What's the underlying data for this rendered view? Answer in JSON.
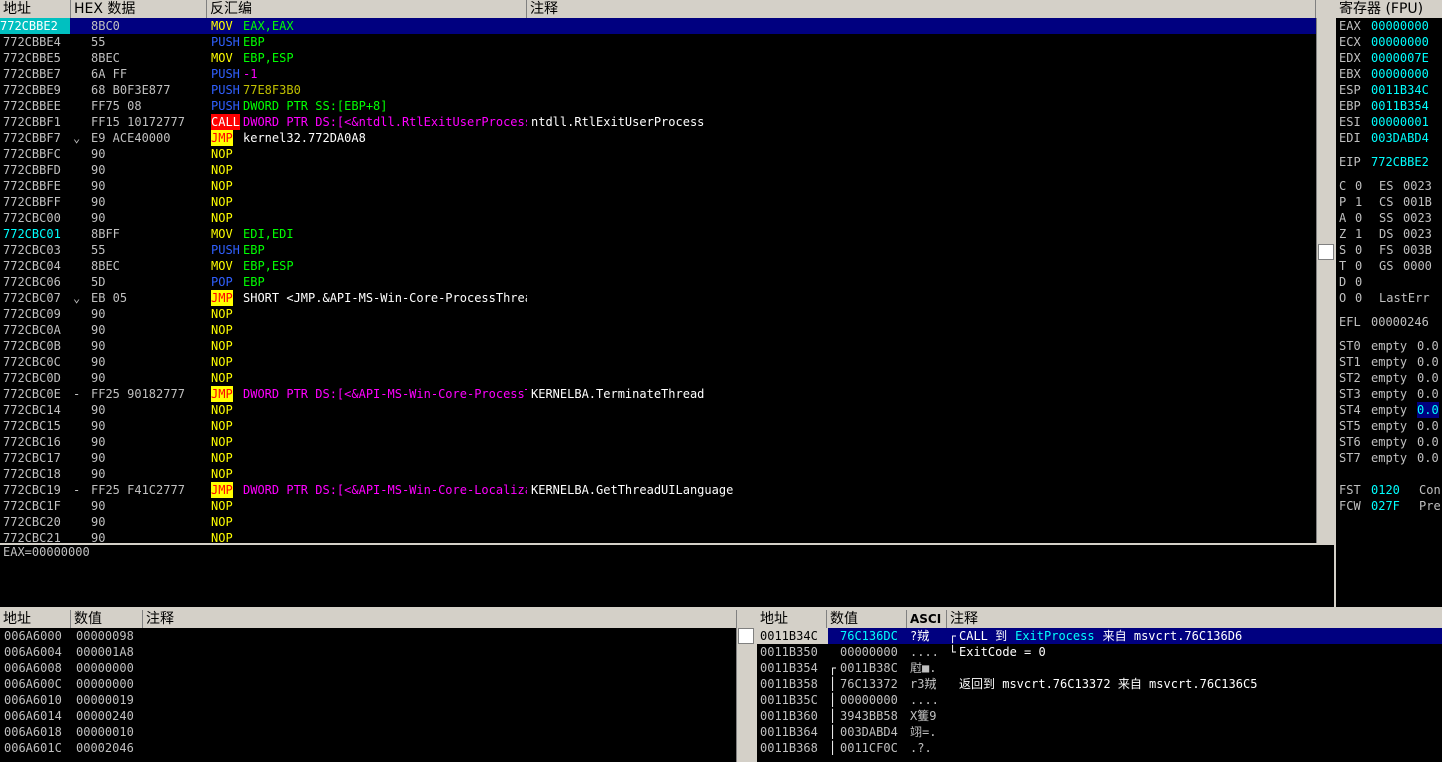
{
  "disasm": {
    "headers": [
      "地址",
      "HEX 数据",
      "反汇编",
      "注释"
    ],
    "rows": [
      {
        "addr": "772CBBE2",
        "hex": "8BC0",
        "mn": "MOV",
        "mnc": "mov",
        "ops": [
          [
            "EAX,EAX",
            "reg"
          ]
        ],
        "cmt": "",
        "cur": true
      },
      {
        "addr": "772CBBE4",
        "hex": "55",
        "mn": "PUSH",
        "mnc": "push",
        "ops": [
          [
            "EBP",
            "reg"
          ]
        ],
        "cmt": ""
      },
      {
        "addr": "772CBBE5",
        "hex": "8BEC",
        "mn": "MOV",
        "mnc": "mov",
        "ops": [
          [
            "EBP,ESP",
            "reg"
          ]
        ],
        "cmt": ""
      },
      {
        "addr": "772CBBE7",
        "hex": "6A FF",
        "mn": "PUSH",
        "mnc": "push",
        "ops": [
          [
            "-1",
            "num"
          ]
        ],
        "cmt": ""
      },
      {
        "addr": "772CBBE9",
        "hex": "68 B0F3E877",
        "mn": "PUSH",
        "mnc": "push",
        "ops": [
          [
            "77E8F3B0",
            "const"
          ]
        ],
        "cmt": ""
      },
      {
        "addr": "772CBBEE",
        "hex": "FF75 08",
        "mn": "PUSH",
        "mnc": "push",
        "ops": [
          [
            "DWORD PTR SS:[EBP+8]",
            "reg"
          ]
        ],
        "cmt": ""
      },
      {
        "addr": "772CBBF1",
        "hex": "FF15 10172777",
        "mn": "CALL",
        "mnc": "call",
        "ops": [
          [
            "DWORD PTR DS:[<&ntdll.RtlExitUserProcess>]",
            "mem"
          ]
        ],
        "cmt": "ntdll.RtlExitUserProcess"
      },
      {
        "addr": "772CBBF7",
        "arrow": "⌄",
        "hex": "E9 ACE40000",
        "mn": "JMP",
        "mnc": "jmp",
        "ops": [
          [
            "kernel32.772DA0A8",
            "lbl"
          ]
        ],
        "cmt": ""
      },
      {
        "addr": "772CBBFC",
        "hex": "90",
        "mn": "NOP",
        "mnc": "nop",
        "ops": [],
        "cmt": ""
      },
      {
        "addr": "772CBBFD",
        "hex": "90",
        "mn": "NOP",
        "mnc": "nop",
        "ops": [],
        "cmt": ""
      },
      {
        "addr": "772CBBFE",
        "hex": "90",
        "mn": "NOP",
        "mnc": "nop",
        "ops": [],
        "cmt": ""
      },
      {
        "addr": "772CBBFF",
        "hex": "90",
        "mn": "NOP",
        "mnc": "nop",
        "ops": [],
        "cmt": ""
      },
      {
        "addr": "772CBC00",
        "hex": "90",
        "mn": "NOP",
        "mnc": "nop",
        "ops": [],
        "cmt": ""
      },
      {
        "addr": "772CBC01",
        "hex": "8BFF",
        "mn": "MOV",
        "mnc": "mov",
        "ops": [
          [
            "EDI,EDI",
            "reg"
          ]
        ],
        "cmt": "",
        "cyan": true
      },
      {
        "addr": "772CBC03",
        "hex": "55",
        "mn": "PUSH",
        "mnc": "push",
        "ops": [
          [
            "EBP",
            "reg"
          ]
        ],
        "cmt": ""
      },
      {
        "addr": "772CBC04",
        "hex": "8BEC",
        "mn": "MOV",
        "mnc": "mov",
        "ops": [
          [
            "EBP,ESP",
            "reg"
          ]
        ],
        "cmt": ""
      },
      {
        "addr": "772CBC06",
        "hex": "5D",
        "mn": "POP",
        "mnc": "pop",
        "ops": [
          [
            "EBP",
            "reg"
          ]
        ],
        "cmt": ""
      },
      {
        "addr": "772CBC07",
        "arrow": "⌄",
        "hex": "EB 05",
        "mn": "JMP",
        "mnc": "jmp",
        "ops": [
          [
            "SHORT <JMP.&API-MS-Win-Core-ProcessThreads>",
            "lbl"
          ]
        ],
        "cmt": ""
      },
      {
        "addr": "772CBC09",
        "hex": "90",
        "mn": "NOP",
        "mnc": "nop",
        "ops": [],
        "cmt": ""
      },
      {
        "addr": "772CBC0A",
        "hex": "90",
        "mn": "NOP",
        "mnc": "nop",
        "ops": [],
        "cmt": ""
      },
      {
        "addr": "772CBC0B",
        "hex": "90",
        "mn": "NOP",
        "mnc": "nop",
        "ops": [],
        "cmt": ""
      },
      {
        "addr": "772CBC0C",
        "hex": "90",
        "mn": "NOP",
        "mnc": "nop",
        "ops": [],
        "cmt": ""
      },
      {
        "addr": "772CBC0D",
        "hex": "90",
        "mn": "NOP",
        "mnc": "nop",
        "ops": [],
        "cmt": ""
      },
      {
        "addr": "772CBC0E",
        "arrow": "-",
        "hex": "FF25 90182777",
        "mn": "JMP",
        "mnc": "jmp",
        "ops": [
          [
            "DWORD PTR DS:[<&API-MS-Win-Core-ProcessThreads>]",
            "mem"
          ]
        ],
        "cmt": "KERNELBA.TerminateThread"
      },
      {
        "addr": "772CBC14",
        "hex": "90",
        "mn": "NOP",
        "mnc": "nop",
        "ops": [],
        "cmt": ""
      },
      {
        "addr": "772CBC15",
        "hex": "90",
        "mn": "NOP",
        "mnc": "nop",
        "ops": [],
        "cmt": ""
      },
      {
        "addr": "772CBC16",
        "hex": "90",
        "mn": "NOP",
        "mnc": "nop",
        "ops": [],
        "cmt": ""
      },
      {
        "addr": "772CBC17",
        "hex": "90",
        "mn": "NOP",
        "mnc": "nop",
        "ops": [],
        "cmt": ""
      },
      {
        "addr": "772CBC18",
        "hex": "90",
        "mn": "NOP",
        "mnc": "nop",
        "ops": [],
        "cmt": ""
      },
      {
        "addr": "772CBC19",
        "arrow": "-",
        "hex": "FF25 F41C2777",
        "mn": "JMP",
        "mnc": "jmp",
        "ops": [
          [
            "DWORD PTR DS:[<&API-MS-Win-Core-Localization>]",
            "mem"
          ]
        ],
        "cmt": "KERNELBA.GetThreadUILanguage"
      },
      {
        "addr": "772CBC1F",
        "hex": "90",
        "mn": "NOP",
        "mnc": "nop",
        "ops": [],
        "cmt": ""
      },
      {
        "addr": "772CBC20",
        "hex": "90",
        "mn": "NOP",
        "mnc": "nop",
        "ops": [],
        "cmt": ""
      },
      {
        "addr": "772CBC21",
        "hex": "90",
        "mn": "NOP",
        "mnc": "nop",
        "ops": [],
        "cmt": ""
      }
    ]
  },
  "info": {
    "text": "EAX=00000000"
  },
  "registers": {
    "header": "寄存器 (FPU)",
    "gp": [
      [
        "EAX",
        "00000000"
      ],
      [
        "ECX",
        "00000000"
      ],
      [
        "EDX",
        "0000007E"
      ],
      [
        "EBX",
        "00000000"
      ],
      [
        "ESP",
        "0011B34C"
      ],
      [
        "EBP",
        "0011B354"
      ],
      [
        "ESI",
        "00000001"
      ],
      [
        "EDI",
        "003DABD4"
      ]
    ],
    "eip": [
      "EIP",
      "772CBBE2"
    ],
    "flags": [
      [
        "C",
        "0",
        "ES",
        "0023"
      ],
      [
        "P",
        "1",
        "CS",
        "001B"
      ],
      [
        "A",
        "0",
        "SS",
        "0023"
      ],
      [
        "Z",
        "1",
        "DS",
        "0023"
      ],
      [
        "S",
        "0",
        "FS",
        "003B"
      ],
      [
        "T",
        "0",
        "GS",
        "0000"
      ],
      [
        "D",
        "0",
        "",
        ""
      ],
      [
        "O",
        "0",
        "LastErr",
        ""
      ]
    ],
    "efl": [
      "EFL",
      "00000246"
    ],
    "fpu": [
      [
        "ST0",
        "empty",
        "0.0"
      ],
      [
        "ST1",
        "empty",
        "0.0"
      ],
      [
        "ST2",
        "empty",
        "0.0"
      ],
      [
        "ST3",
        "empty",
        "0.0"
      ],
      [
        "ST4",
        "empty",
        "0.0"
      ],
      [
        "ST5",
        "empty",
        "0.0"
      ],
      [
        "ST6",
        "empty",
        "0.0"
      ],
      [
        "ST7",
        "empty",
        "0.0"
      ]
    ],
    "fst": [
      "FST",
      "0120",
      "Con"
    ],
    "fcw": [
      "FCW",
      "027F",
      "Pre"
    ]
  },
  "dump": {
    "headers": [
      "地址",
      "数值",
      "注释"
    ],
    "rows": [
      [
        "006A6000",
        "00000098"
      ],
      [
        "006A6004",
        "000001A8"
      ],
      [
        "006A6008",
        "00000000"
      ],
      [
        "006A600C",
        "00000000"
      ],
      [
        "006A6010",
        "00000019"
      ],
      [
        "006A6014",
        "00000240"
      ],
      [
        "006A6018",
        "00000010"
      ],
      [
        "006A601C",
        "00002046"
      ]
    ]
  },
  "stack": {
    "headers": [
      "地址",
      "数值",
      "ASCI",
      "注释"
    ],
    "rows": [
      {
        "addr": "0011B34C",
        "val": "76C136DC",
        "ascii": "?羢",
        "br": "┌",
        "cmt_parts": [
          [
            "CALL 到 ",
            "w"
          ],
          [
            "ExitProcess",
            "c"
          ],
          [
            " 来自 msvcrt.76C136D6",
            "w"
          ]
        ],
        "sel": true
      },
      {
        "addr": "0011B350",
        "val": "00000000",
        "ascii": "....",
        "br": "└",
        "cmt_parts": [
          [
            "ExitCode = 0",
            "w"
          ]
        ]
      },
      {
        "addr": "0011B354",
        "val": "0011B38C",
        "ascii": "屗■.",
        "br": "┌",
        "cmt_parts": []
      },
      {
        "addr": "0011B358",
        "val": "76C13372",
        "ascii": "r3羢",
        "br": "│",
        "cmt_parts": [
          [
            "返回到 msvcrt.76C13372 来自 msvcrt.76C136C5",
            "w"
          ]
        ]
      },
      {
        "addr": "0011B35C",
        "val": "00000000",
        "ascii": "....",
        "br": "│",
        "cmt_parts": []
      },
      {
        "addr": "0011B360",
        "val": "3943BB58",
        "ascii": "X籆9",
        "br": "│",
        "cmt_parts": []
      },
      {
        "addr": "0011B364",
        "val": "003DABD4",
        "ascii": "翊=.",
        "br": "│",
        "cmt_parts": []
      },
      {
        "addr": "0011B368",
        "val": "0011CF0C",
        "ascii": ".?.",
        "br": "│",
        "cmt_parts": []
      }
    ]
  }
}
